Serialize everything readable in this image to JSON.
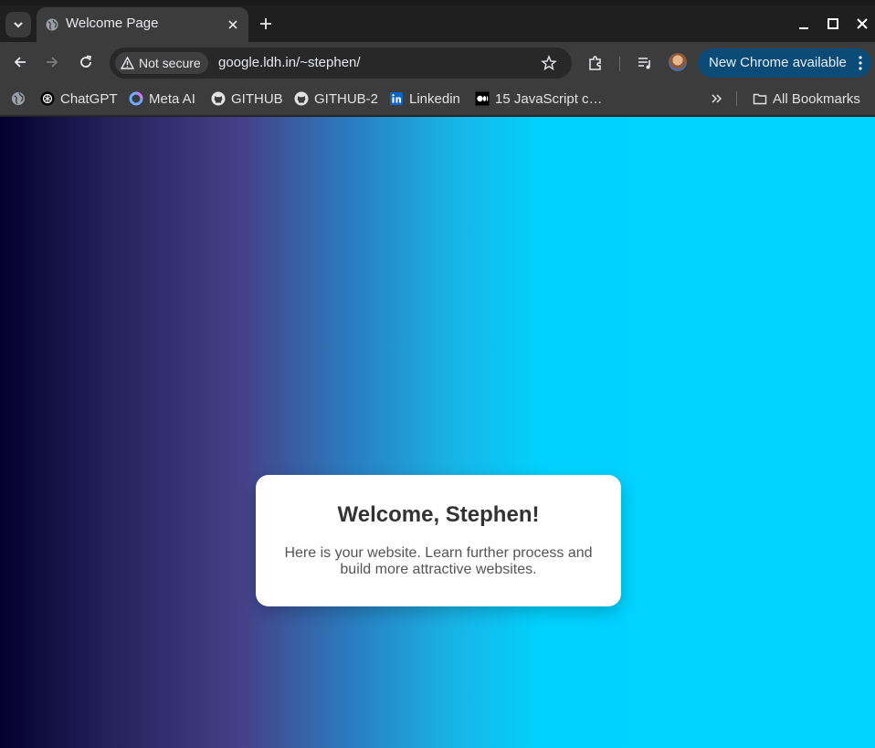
{
  "browser": {
    "tab": {
      "title": "Welcome Page"
    },
    "omnibox": {
      "security_label": "Not secure",
      "url": "google.ldh.in/~stephen/"
    },
    "update_chip": {
      "label": "New Chrome available"
    },
    "bookmarks": [
      {
        "label": "ChatGPT",
        "icon": "chatgpt-icon"
      },
      {
        "label": "Meta AI",
        "icon": "meta-ai-icon"
      },
      {
        "label": "GITHUB",
        "icon": "github-icon"
      },
      {
        "label": "GITHUB-2",
        "icon": "github-icon"
      },
      {
        "label": "Linkedin",
        "icon": "linkedin-icon"
      },
      {
        "label": "15 JavaScript c…",
        "icon": "medium-icon"
      }
    ],
    "all_bookmarks_label": "All Bookmarks",
    "colors": {
      "update_chip": "#0b4b77",
      "tab_active": "#3c3c3c"
    }
  },
  "page": {
    "card": {
      "title": "Welcome, Stephen!",
      "message": "Here is your website. Learn further process and build more attractive websites."
    },
    "colors": {
      "gradient_start": "#03002e",
      "gradient_mid": "#454289",
      "gradient_end": "#00d4ff"
    }
  }
}
